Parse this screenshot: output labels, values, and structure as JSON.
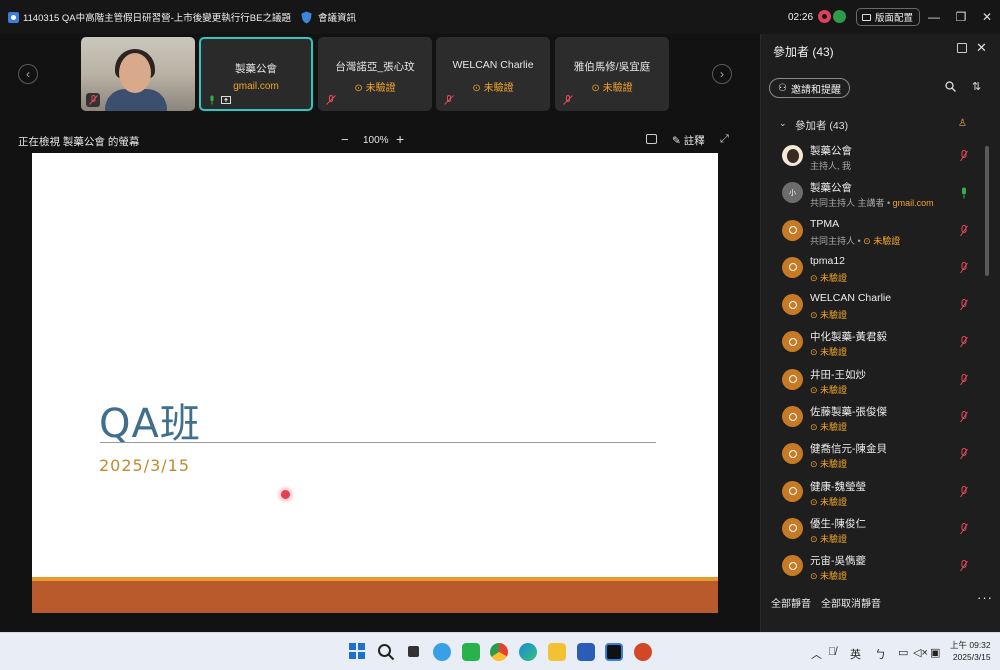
{
  "window": {
    "title": "1140315 QA中高階主管假日研習營-上市後變更執行行BE之議題",
    "meeting_info_label": "會議資訊",
    "timer": "02:26",
    "layout_label": "版面配置"
  },
  "strip": {
    "tiles": [
      {
        "name": "製藥公會",
        "sub": "gmail.com"
      },
      {
        "name": "台灣諾亞_張心玟",
        "sub": "未驗證"
      },
      {
        "name": "WELCAN Charlie",
        "sub": "未驗證"
      },
      {
        "name": "雅伯馬修/吳宜庭",
        "sub": "未驗證"
      }
    ]
  },
  "share": {
    "viewing_label": "正在檢視 製藥公會 的螢幕",
    "zoom_minus": "−",
    "zoom_value": "100%",
    "zoom_plus": "+",
    "annotate_label": "註釋"
  },
  "slide": {
    "title": "QA班",
    "date": "2025/3/15"
  },
  "panel": {
    "title": "參加者 (43)",
    "invite_label": "邀請和提醒",
    "group_label": "參加者 (43)",
    "participants": [
      {
        "name": "製藥公會",
        "sub": "主持人, 我",
        "sub_warn": ""
      },
      {
        "name": "製藥公會",
        "sub": "共同主持人 主講者 • ",
        "sub_warn": "gmail.com"
      },
      {
        "name": "TPMA",
        "sub": "共同主持人 • ",
        "sub_warn": "未驗證"
      },
      {
        "name": "tpma12",
        "sub": "",
        "sub_warn": "未驗證"
      },
      {
        "name": "WELCAN Charlie",
        "sub": "",
        "sub_warn": "未驗證"
      },
      {
        "name": "中化製藥-黃君毅",
        "sub": "",
        "sub_warn": "未驗證"
      },
      {
        "name": "井田-王如炒",
        "sub": "",
        "sub_warn": "未驗證"
      },
      {
        "name": "佐藤製藥-張俊傑",
        "sub": "",
        "sub_warn": "未驗證"
      },
      {
        "name": "健喬信元-陳金貝",
        "sub": "",
        "sub_warn": "未驗證"
      },
      {
        "name": "健康-魏瑩瑩",
        "sub": "",
        "sub_warn": "未驗證"
      },
      {
        "name": "優生-陳俊仁",
        "sub": "",
        "sub_warn": "未驗證"
      },
      {
        "name": "元宙-吳儁夔",
        "sub": "",
        "sub_warn": "未驗證"
      }
    ],
    "mute_all": "全部靜音",
    "unmute_all": "全部取消靜音"
  },
  "taskbar": {
    "ime": "英",
    "time": "上午 09:32",
    "date": "2025/3/15"
  },
  "colors": {
    "accent_cyan": "#2fc7c2",
    "warning_orange": "#f0a32a",
    "slide_title": "#3f6f8f",
    "slide_date": "#c08b30",
    "slide_band": "#b95a2c"
  }
}
